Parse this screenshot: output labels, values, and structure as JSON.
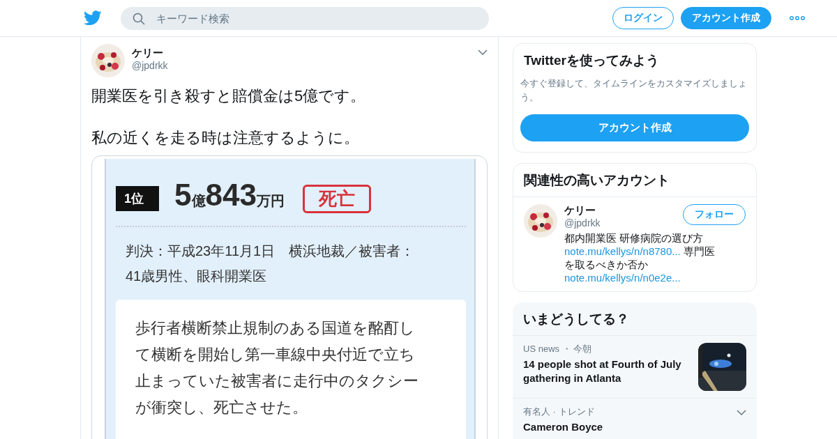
{
  "header": {
    "search": {
      "placeholder": "キーワード検索"
    },
    "login": "ログイン",
    "signup": "アカウント作成"
  },
  "tweet": {
    "name": "ケリー",
    "handle": "@jpdrkk",
    "text": [
      "開業医を引き殺すと賠償金は5億です。",
      "私の近くを走る時は注意するように。"
    ],
    "document": {
      "rank": "1位",
      "amount": [
        {
          "text": "5",
          "kind": "big"
        },
        {
          "text": "億",
          "kind": "small"
        },
        {
          "text": "843",
          "kind": "big"
        },
        {
          "text": "万円",
          "kind": "small"
        }
      ],
      "stamp": "死亡",
      "verdict": [
        "判決：平成23年11月1日　横浜地裁／被害者：",
        "41歳男性、眼科開業医"
      ],
      "body": [
        "歩行者横断禁止規制のある国道を酩酊し",
        "て横断を開始し第一車線中央付近で立ち",
        "止まっていた被害者に走行中のタクシー",
        "が衝突し、死亡させた。"
      ]
    }
  },
  "signup_card": {
    "title": "Twitterを使ってみよう",
    "text": "今すぐ登録して、タイムラインをカスタマイズしましょう。",
    "button": "アカウント作成"
  },
  "related": {
    "title": "関連性の高いアカウント",
    "accounts": [
      {
        "name": "ケリー",
        "handle": "@jpdrkk",
        "follow": "フォロー",
        "bio": [
          {
            "kind": "text",
            "text": "都内開業医 研修病院の選び方"
          },
          {
            "kind": "link",
            "text": "note.mu/kellys/n/n8780..."
          },
          {
            "kind": "text",
            "text": " 専門医を取るべきか否か"
          },
          {
            "kind": "link",
            "text": "note.mu/kellys/n/n0e2e..."
          }
        ]
      }
    ]
  },
  "trends": {
    "title": "いまどうしてる？",
    "items": [
      {
        "kind": "news",
        "context": "US news ・ 今朝",
        "title": "14 people shot at Fourth of July gathering in Atlanta"
      },
      {
        "kind": "trend",
        "context": "有名人 · トレンド",
        "title": "Cameron Boyce"
      }
    ]
  }
}
